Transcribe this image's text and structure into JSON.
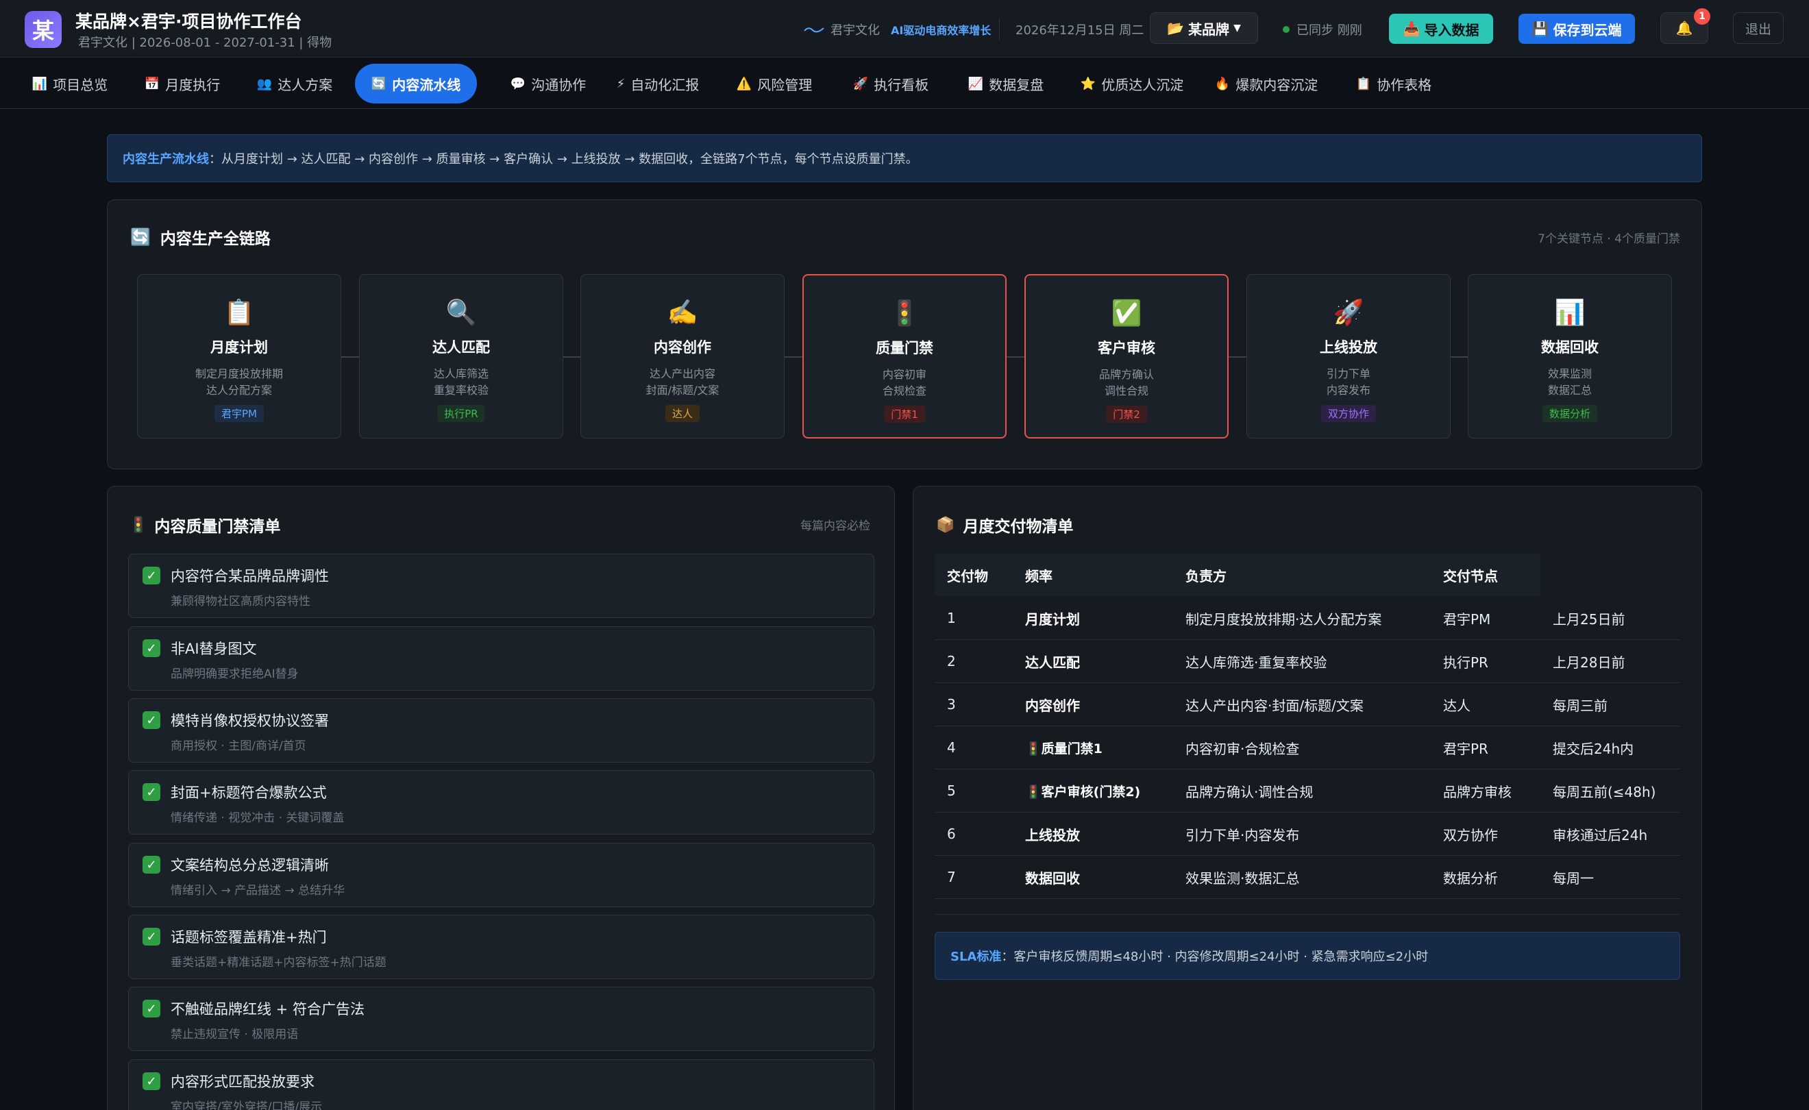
{
  "header": {
    "logo_char": "某",
    "title": "某品牌×君宇·项目协作工作台",
    "subtitle": "君宇文化 | 2026-08-01 - 2027-01-31 | 得物",
    "company_logo_text": "君宇文化",
    "slogan": "AI驱动电商效率增长",
    "date": "2026年12月15日 周二",
    "brand_select": "某品牌",
    "sync_status": "已同步 刚刚",
    "import_label": "导入数据",
    "save_label": "保存到云端",
    "notif_count": "1",
    "logout_label": "退出",
    "colors": {
      "import": "#2bc6b5",
      "save": "#1f6feb",
      "sync_dot": "#2ea043",
      "badge": "#f85149"
    }
  },
  "nav": {
    "tabs": [
      {
        "icon": "📊",
        "label": "项目总览"
      },
      {
        "icon": "📅",
        "label": "月度执行"
      },
      {
        "icon": "👥",
        "label": "达人方案"
      },
      {
        "icon": "🔄",
        "label": "内容流水线"
      },
      {
        "icon": "💬",
        "label": "沟通协作"
      },
      {
        "icon": "⚡",
        "label": "自动化汇报"
      },
      {
        "icon": "⚠️",
        "label": "风险管理"
      },
      {
        "icon": "🚀",
        "label": "执行看板"
      },
      {
        "icon": "📈",
        "label": "数据复盘"
      },
      {
        "icon": "⭐",
        "label": "优质达人沉淀"
      },
      {
        "icon": "🔥",
        "label": "爆款内容沉淀"
      },
      {
        "icon": "📋",
        "label": "协作表格"
      }
    ],
    "active": "内容流水线"
  },
  "banner": {
    "lead": "内容生产流水线",
    "text": "：从月度计划 → 达人匹配 → 内容创作 → 质量审核 → 客户确认 → 上线投放 → 数据回收，全链路7个节点，每个节点设质量门禁。"
  },
  "pipeline": {
    "icon": "🔄",
    "title": "内容生产全链路",
    "note": "7个关键节点 · 4个质量门禁",
    "nodes": [
      {
        "icon": "📋",
        "name": "月度计划",
        "d1": "制定月度投放排期",
        "d2": "达人分配方案",
        "tag": "君宇PM",
        "tag_color": "#58a6ff",
        "tag_bg": "#1c2d45",
        "gate": false
      },
      {
        "icon": "🔍",
        "name": "达人匹配",
        "d1": "达人库筛选",
        "d2": "重复率校验",
        "tag": "执行PR",
        "tag_color": "#3fb950",
        "tag_bg": "#1a3324",
        "gate": false
      },
      {
        "icon": "✍️",
        "name": "内容创作",
        "d1": "达人产出内容",
        "d2": "封面/标题/文案",
        "tag": "达人",
        "tag_color": "#e3a84d",
        "tag_bg": "#3a2d17",
        "gate": false
      },
      {
        "icon": "🚦",
        "name": "质量门禁",
        "d1": "内容初审",
        "d2": "合规检查",
        "tag": "门禁1",
        "tag_color": "#f85149",
        "tag_bg": "#3d1d1f",
        "gate": true
      },
      {
        "icon": "✅",
        "name": "客户审核",
        "d1": "品牌方确认",
        "d2": "调性合规",
        "tag": "门禁2",
        "tag_color": "#f85149",
        "tag_bg": "#3d1d1f",
        "gate": true
      },
      {
        "icon": "🚀",
        "name": "上线投放",
        "d1": "引力下单",
        "d2": "内容发布",
        "tag": "双方协作",
        "tag_color": "#a371f7",
        "tag_bg": "#2d2147",
        "gate": false
      },
      {
        "icon": "📊",
        "name": "数据回收",
        "d1": "效果监测",
        "d2": "数据汇总",
        "tag": "数据分析",
        "tag_color": "#3fb950",
        "tag_bg": "#1a3324",
        "gate": false
      }
    ]
  },
  "quality": {
    "icon": "🚦",
    "title": "内容质量门禁清单",
    "note": "每篇内容必检",
    "items": [
      {
        "title": "内容符合某品牌品牌调性",
        "sub": "兼顾得物社区高质内容特性"
      },
      {
        "title": "非AI替身图文",
        "sub": "品牌明确要求拒绝AI替身"
      },
      {
        "title": "模特肖像权授权协议签署",
        "sub": "商用授权 · 主图/商详/首页"
      },
      {
        "title": "封面+标题符合爆款公式",
        "sub": "情绪传递 · 视觉冲击 · 关键词覆盖"
      },
      {
        "title": "文案结构总分总逻辑清晰",
        "sub": "情绪引入 → 产品描述 → 总结升华"
      },
      {
        "title": "话题标签覆盖精准+热门",
        "sub": "垂类话题+精准话题+内容标签+热门话题"
      },
      {
        "title": "不触碰品牌红线 + 符合广告法",
        "sub": "禁止违规宣传 · 极限用语"
      },
      {
        "title": "内容形式匹配投放要求",
        "sub": "室内穿搭/室外穿搭/口播/展示"
      }
    ]
  },
  "delivery": {
    "icon": "📦",
    "title": "月度交付物清单",
    "headers": [
      "交付物",
      "频率",
      "负责方",
      "交付节点"
    ],
    "rows": [
      {
        "no": "1",
        "name": "月度计划",
        "desc": "制定月度投放排期·达人分配方案",
        "owner": "君宇PM",
        "when": "上月25日前"
      },
      {
        "no": "2",
        "name": "达人匹配",
        "desc": "达人库筛选·重复率校验",
        "owner": "执行PR",
        "when": "上月28日前"
      },
      {
        "no": "3",
        "name": "内容创作",
        "desc": "达人产出内容·封面/标题/文案",
        "owner": "达人",
        "when": "每周三前"
      },
      {
        "no": "4",
        "name": "🚦质量门禁1",
        "desc": "内容初审·合规检查",
        "owner": "君宇PR",
        "when": "提交后24h内"
      },
      {
        "no": "5",
        "name": "🚦客户审核(门禁2)",
        "desc": "品牌方确认·调性合规",
        "owner": "品牌方审核",
        "when": "每周五前(≤48h)"
      },
      {
        "no": "6",
        "name": "上线投放",
        "desc": "引力下单·内容发布",
        "owner": "双方协作",
        "when": "审核通过后24h"
      },
      {
        "no": "7",
        "name": "数据回收",
        "desc": "效果监测·数据汇总",
        "owner": "数据分析",
        "when": "每周一"
      }
    ],
    "sla_lead": "SLA标准",
    "sla_text": "：客户审核反馈周期≤48小时 · 内容修改周期≤24小时 · 紧急需求响应≤2小时"
  }
}
